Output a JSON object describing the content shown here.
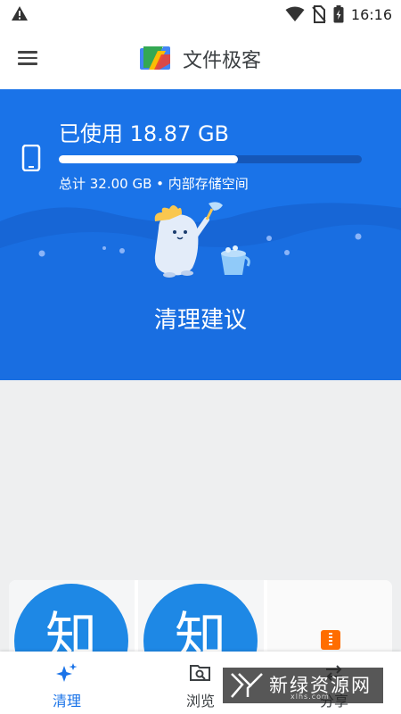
{
  "status_bar": {
    "time": "16:16"
  },
  "app_bar": {
    "title": "文件极客"
  },
  "storage": {
    "used_label": "已使用 18.87 GB",
    "used_fraction": 0.59,
    "total_label": "总计 32.00 GB • 内部存储空间"
  },
  "clean_suggestion": {
    "title": "清理建议"
  },
  "cards": [
    {
      "glyph": "知"
    },
    {
      "glyph": "知"
    }
  ],
  "bottom_nav": {
    "items": [
      {
        "label": "清理",
        "icon": "sparkle-icon",
        "active": true
      },
      {
        "label": "浏览",
        "icon": "browse-icon",
        "active": false
      },
      {
        "label": "分享",
        "icon": "share-icon",
        "active": false
      }
    ]
  },
  "watermark": {
    "text": "新绿资源网",
    "url": "xlhs.com"
  },
  "colors": {
    "primary": "#1a73e8",
    "bar_track": "#1557b8",
    "zip_orange": "#ff6d00"
  }
}
